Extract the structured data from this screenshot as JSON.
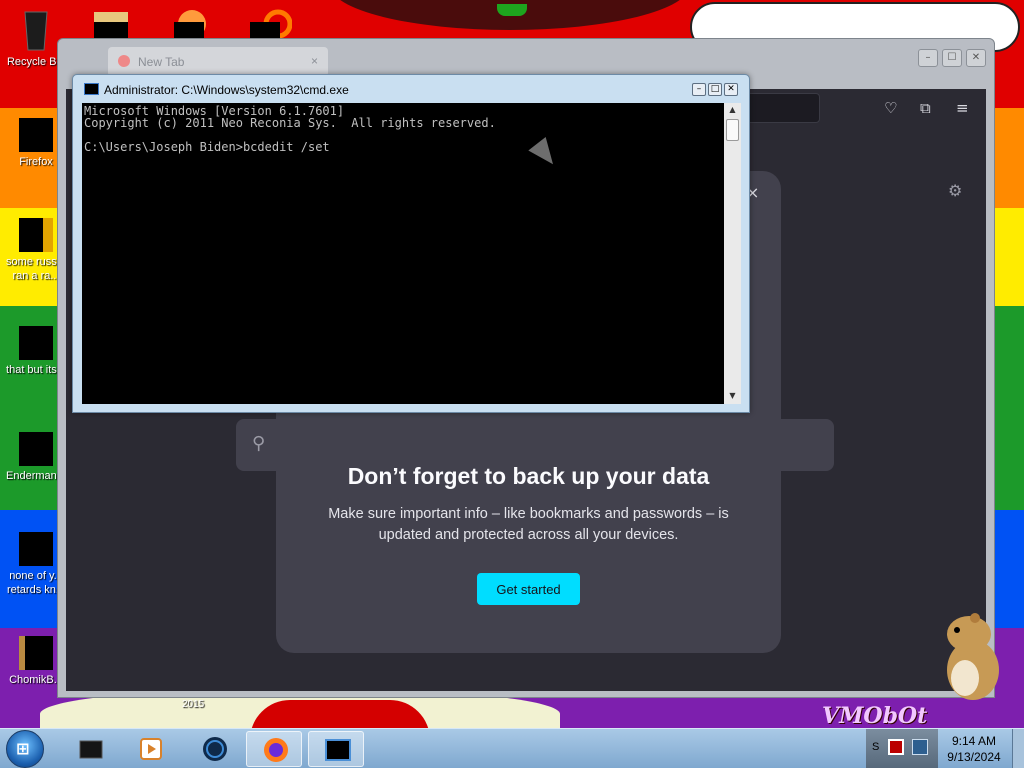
{
  "desktop": {
    "wallpaper_colors": [
      "#e00000",
      "#ff8a00",
      "#ffec00",
      "#1c9a2a",
      "#0052f4",
      "#7d1fae"
    ],
    "wallpaper_text": "VMObOt",
    "icons": [
      {
        "name": "recycle-bin",
        "label": "Recycle Bin"
      },
      {
        "name": "firefox",
        "label": "Firefox"
      },
      {
        "name": "some-russian",
        "label": "some russ... ran a ra..."
      },
      {
        "name": "that-but-its",
        "label": "that but its..."
      },
      {
        "name": "enderman",
        "label": "Enderman..."
      },
      {
        "name": "none-of-y",
        "label": "none of y... retards kn..."
      },
      {
        "name": "chomik",
        "label": "ChomikB..."
      }
    ],
    "year_caption": "2015"
  },
  "browser": {
    "tab_label": "New Tab",
    "tab_close": "×",
    "caption_buttons": [
      "–",
      "☐",
      "✕"
    ],
    "toolbar_icons": [
      "pocket-icon",
      "extensions-icon",
      "menu-icon"
    ],
    "card": {
      "title": "Don’t forget to back up your data",
      "body": "Make sure important info – like bookmarks and passwords – is updated and protected across all your devices.",
      "cta": "Get started",
      "close": "×"
    },
    "colors": {
      "bg": "#2b2a33",
      "card": "#42414d",
      "accent": "#00ddff"
    }
  },
  "cmd": {
    "title": "Administrator: C:\\Windows\\system32\\cmd.exe",
    "lines": [
      "Microsoft Windows [Version 6.1.7601]",
      "Copyright (c) 2011 Neo Reconia Sys.  All rights reserved.",
      "",
      "C:\\Users\\Joseph Biden>bcdedit /set"
    ],
    "caption_buttons": [
      "–",
      "□",
      "✕"
    ]
  },
  "taskbar": {
    "start_glyph": "⊞",
    "apps": [
      "explorer-icon",
      "media-player-icon",
      "globe-icon",
      "firefox-icon",
      "cmd-icon"
    ],
    "tray_overflow": "S",
    "time": "9:14 AM",
    "date": "9/13/2024"
  }
}
